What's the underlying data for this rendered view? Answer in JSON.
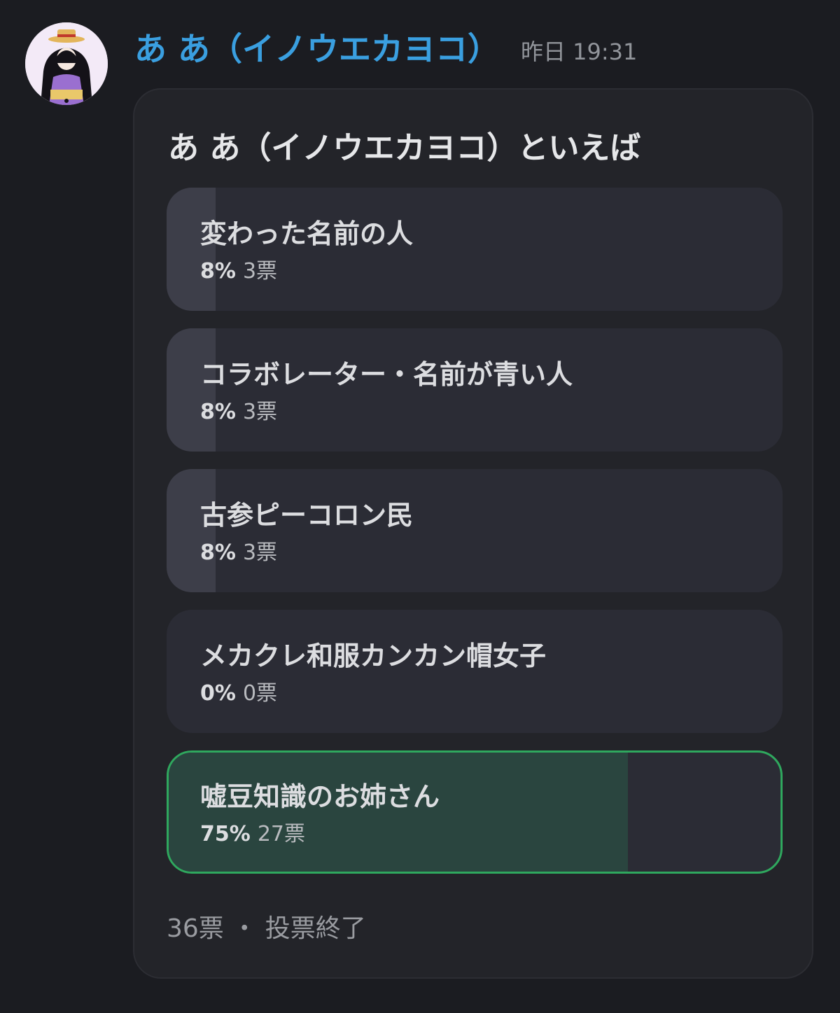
{
  "message": {
    "author": "あ あ（イノウエカヨコ）",
    "timestamp": "昨日 19:31",
    "avatar_icon": "user-avatar-icon"
  },
  "poll": {
    "question": "あ あ（イノウエカヨコ）といえば",
    "answers": [
      {
        "label": "変わった名前の人",
        "percent": "8%",
        "votes": "3票",
        "fraction": 0.08,
        "winner": false
      },
      {
        "label": "コラボレーター・名前が青い人",
        "percent": "8%",
        "votes": "3票",
        "fraction": 0.08,
        "winner": false
      },
      {
        "label": "古参ピーコロン民",
        "percent": "8%",
        "votes": "3票",
        "fraction": 0.08,
        "winner": false
      },
      {
        "label": "メカクレ和服カンカン帽女子",
        "percent": "0%",
        "votes": "0票",
        "fraction": 0.0,
        "winner": false
      },
      {
        "label": "嘘豆知識のお姉さん",
        "percent": "75%",
        "votes": "27票",
        "fraction": 0.75,
        "winner": true
      }
    ],
    "footer": "36票 ・ 投票終了"
  },
  "colors": {
    "background": "#1b1c21",
    "author": "#3a9fe0",
    "winner_border": "#2fa85e",
    "winner_fill": "#2a453f",
    "answer_fill": "#3d3e49"
  }
}
